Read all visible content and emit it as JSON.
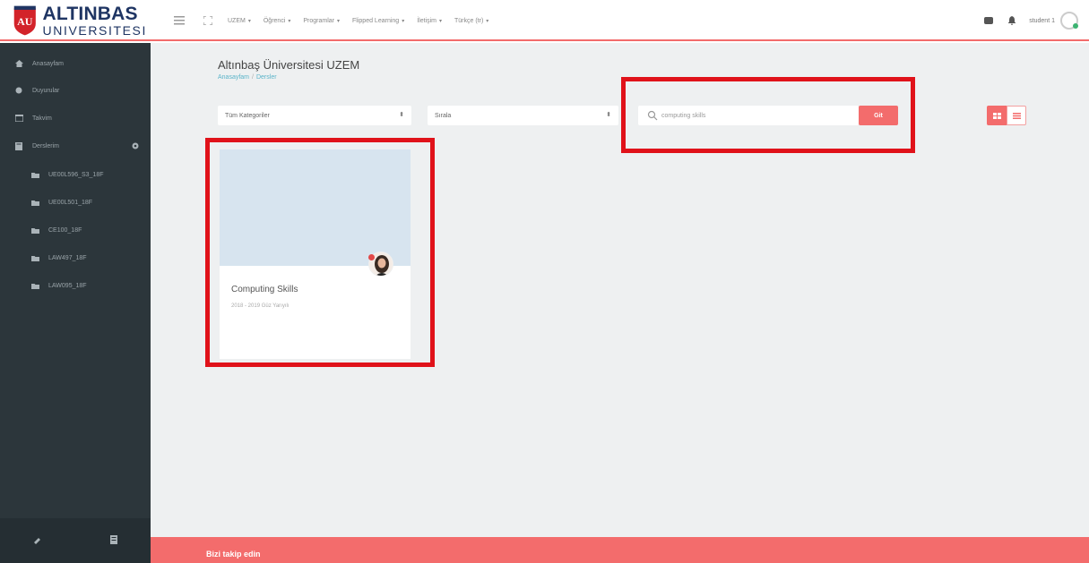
{
  "brand": {
    "name": "ALTINBAS",
    "sub": "UNIVERSITESI",
    "colors": {
      "primary": "#1f3563",
      "accent": "#f36c6c",
      "sidebar": "#2c363b",
      "highlight": "#e0121a"
    }
  },
  "topnav": {
    "icons": [
      "hamburger-icon",
      "fullscreen-icon"
    ],
    "items": [
      {
        "label": "UZEM"
      },
      {
        "label": "Öğrenci"
      },
      {
        "label": "Programlar"
      },
      {
        "label": "Flipped Learning"
      },
      {
        "label": "İletişim"
      },
      {
        "label": "Türkçe (tr)"
      }
    ],
    "right": {
      "user": "student 1",
      "icons": [
        "message-icon",
        "bell-icon"
      ]
    }
  },
  "sidebar": {
    "items": [
      {
        "label": "Anasayfam",
        "icon": "home-icon"
      },
      {
        "label": "Duyurular",
        "icon": "tag-icon"
      },
      {
        "label": "Takvim",
        "icon": "calendar-icon"
      },
      {
        "label": "Derslerim",
        "icon": "book-icon"
      }
    ],
    "courses": [
      {
        "label": "UE00L596_S3_18F"
      },
      {
        "label": "UE00L501_18F"
      },
      {
        "label": "CE100_18F"
      },
      {
        "label": "LAW497_18F"
      },
      {
        "label": "LAW095_18F"
      }
    ]
  },
  "main": {
    "title": "Altınbaş Üniversitesi UZEM",
    "breadcrumb": [
      "Anasayfam",
      "Dersler"
    ],
    "category_select": "Tüm Kategoriler",
    "sort_select": "Sırala",
    "search_value": "computing skills",
    "go_label": "Git",
    "course_card": {
      "title": "Computing Skills",
      "subtitle": "2018 - 2019 Güz Yarıyılı"
    }
  },
  "footer": {
    "text": "Bizi takip edin"
  }
}
